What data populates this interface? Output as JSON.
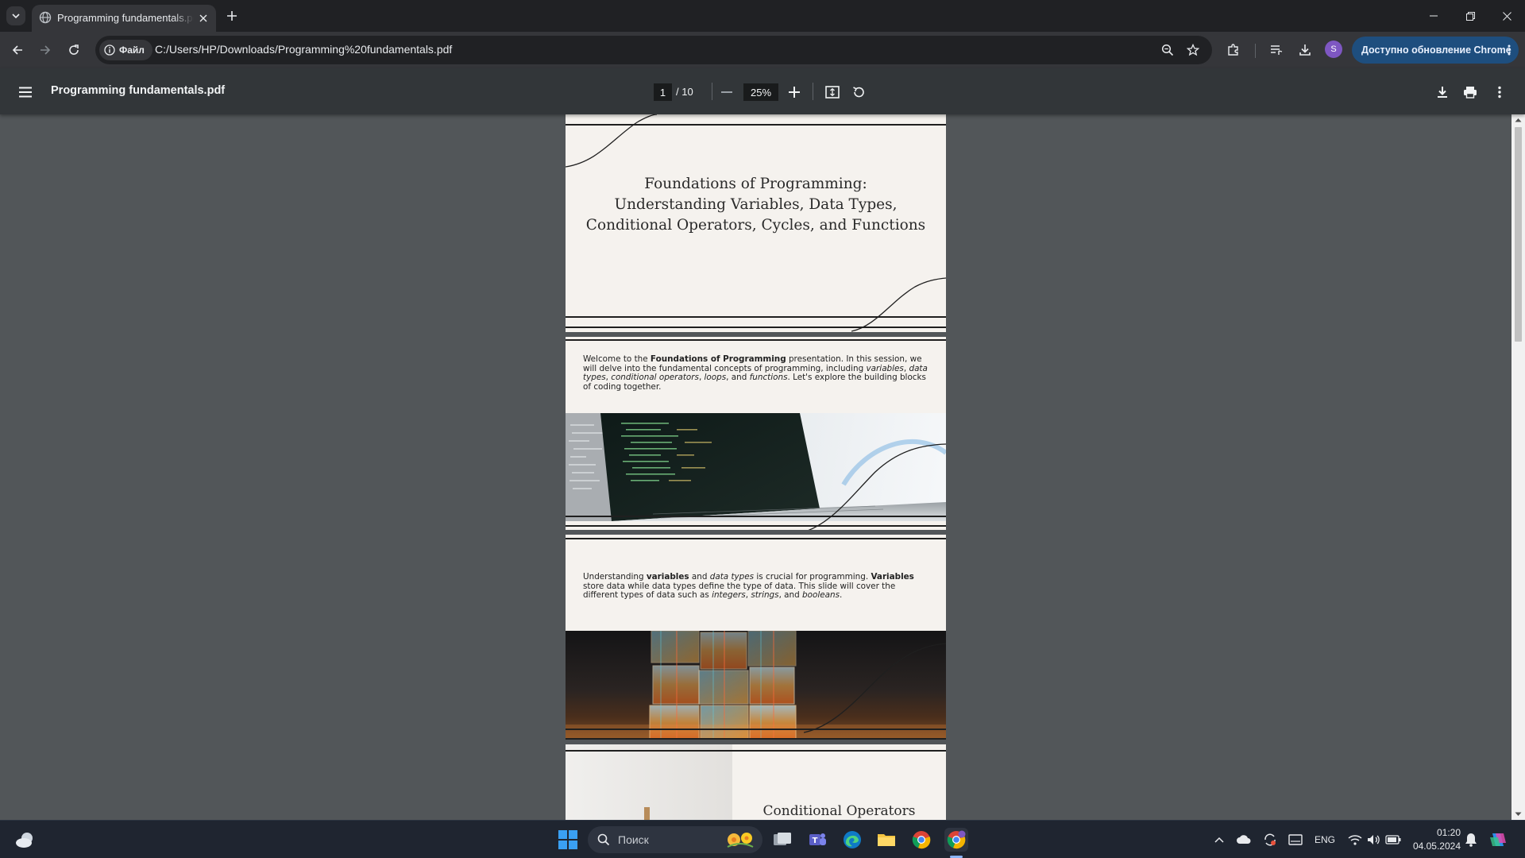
{
  "browser": {
    "tab": {
      "title": "Programming fundamentals.pdf"
    },
    "address": {
      "scheme_chip": "Файл",
      "url": "C:/Users/HP/Downloads/Programming%20fundamentals.pdf"
    },
    "profile_initial": "S",
    "update_button": "Доступно обновление Chrome"
  },
  "pdf_viewer": {
    "title": "Programming fundamentals.pdf",
    "current_page": "1",
    "total_pages": "/ 10",
    "zoom": "25%"
  },
  "pages": {
    "p1_title_l1": "Foundations of Programming:",
    "p1_title_l2": "Understanding Variables, Data Types,",
    "p1_title_l3": "Conditional Operators, Cycles, and Functions",
    "p2_text": "Welcome to the Foundations of Programming presentation. In this session, we will delve into the fundamental concepts of programming, including variables, data types, conditional operators, loops, and functions. Let's explore the building blocks of coding together.",
    "p3_text": "Understanding variables and data types is crucial for programming. Variables store data while data types define the type of data. This slide will cover the different types of data such as integers, strings, and booleans.",
    "p4_title": "Conditional Operators"
  },
  "taskbar": {
    "search_placeholder": "Поиск",
    "lang": "ENG",
    "time": "01:20",
    "date": "04.05.2024"
  },
  "colors": {
    "accent_update": "#1e4e7e",
    "page_bg": "#f5f2ee",
    "viewer_bg": "#525659"
  }
}
